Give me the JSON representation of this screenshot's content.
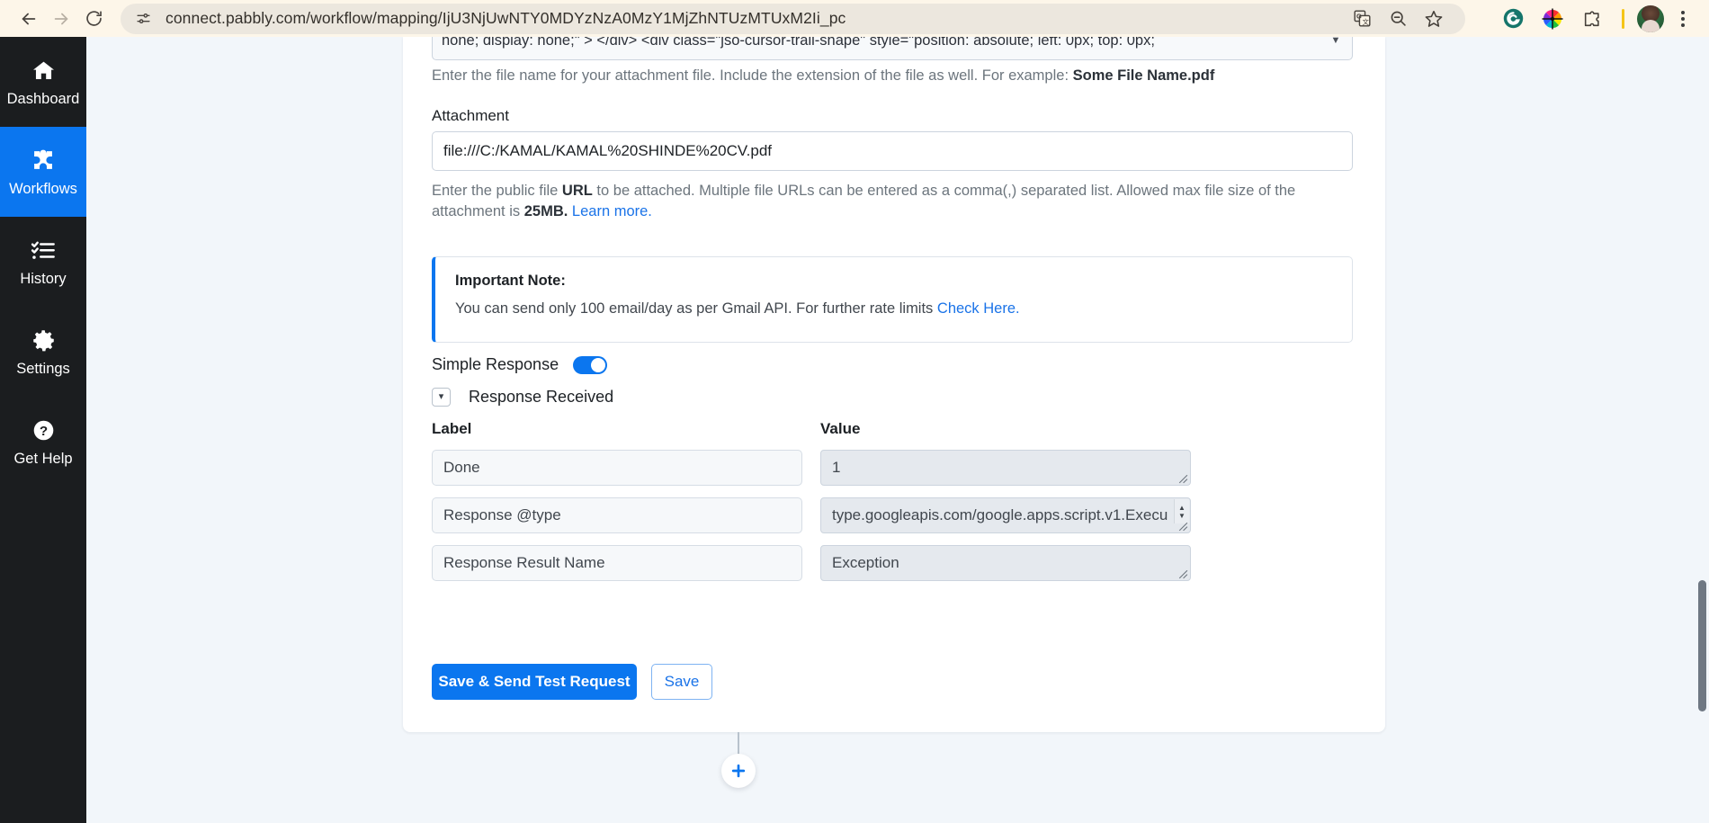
{
  "browser": {
    "back_icon": "back-arrow-icon",
    "forward_icon": "forward-arrow-icon",
    "reload_icon": "reload-icon",
    "site_info_icon": "site-settings-icon",
    "url": "connect.pabbly.com/workflow/mapping/IjU3NjUwNTY0MDYzNzA0MzY1MjZhNTUzMTUxM2Ii_pc",
    "toolbar_icons": [
      "translate-icon",
      "zoom-out-icon",
      "bookmark-star-icon",
      "grammarly-extension-icon",
      "color-picker-extension-icon",
      "extensions-puzzle-icon",
      "profile-avatar",
      "chrome-menu-icon"
    ]
  },
  "sidebar": {
    "items": [
      {
        "label": "Dashboard",
        "icon": "home-icon",
        "active": false
      },
      {
        "label": "Workflows",
        "icon": "workflows-puzzle-icon",
        "active": true
      },
      {
        "label": "History",
        "icon": "history-list-icon",
        "active": false
      },
      {
        "label": "Settings",
        "icon": "gear-icon",
        "active": false
      },
      {
        "label": "Get Help",
        "icon": "help-question-icon",
        "active": false
      }
    ],
    "active_color": "#0b76ef",
    "background": "#1b1d1f"
  },
  "card": {
    "code_select_value": "none; display: none;\" > </div> <div class=\"jso-cursor-trail-shape\" style=\"position: absolute; left: 0px; top: 0px;",
    "filename_help_prefix": "Enter the file name for your attachment file. Include the extension of the file as well. For example: ",
    "filename_help_example": "Some File Name.pdf",
    "attachment_label": "Attachment",
    "attachment_value": "file:///C:/KAMAL/KAMAL%20SHINDE%20CV.pdf",
    "attachment_help_1": "Enter the public file ",
    "attachment_help_url_bold": "URL",
    "attachment_help_2": " to be attached. Multiple file URLs can be entered as a comma(,) separated list. Allowed max file size of the attachment is ",
    "attachment_help_size_bold": "25MB.",
    "attachment_help_link": "Learn more.",
    "note_title": "Important Note:",
    "note_body_1": "You can send only 100 email/day as per Gmail API. For further rate limits ",
    "note_body_link": "Check Here.",
    "simple_response_label": "Simple Response",
    "simple_response_on": true,
    "response_received_label": "Response Received",
    "response_received_expanded": true,
    "columns": {
      "label": "Label",
      "value": "Value"
    },
    "rows": [
      {
        "label": "Done",
        "value": "1"
      },
      {
        "label": "Response @type",
        "value": "type.googleapis.com/google.apps.script.v1.Execu"
      },
      {
        "label": "Response Result Name",
        "value": "Exception"
      }
    ],
    "save_test_button": "Save & Send Test Request",
    "save_button": "Save",
    "accent_color": "#0b76ef"
  },
  "canvas": {
    "add_step_icon": "plus-icon"
  }
}
